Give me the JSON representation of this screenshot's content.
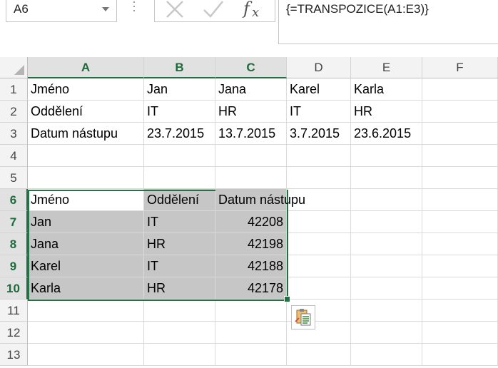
{
  "namebox": {
    "value": "A6"
  },
  "formula_bar": {
    "value": "{=TRANSPOZICE(A1:E3)}"
  },
  "columns": [
    "A",
    "B",
    "C",
    "D",
    "E",
    "F"
  ],
  "selected_columns": [
    "A",
    "B",
    "C"
  ],
  "rows": [
    "1",
    "2",
    "3",
    "4",
    "5",
    "6",
    "7",
    "8",
    "9",
    "10",
    "11",
    "12",
    "13"
  ],
  "selected_rows": [
    "6",
    "7",
    "8",
    "9",
    "10"
  ],
  "cells": {
    "A1": "Jméno",
    "B1": "Jan",
    "C1": "Jana",
    "D1": "Karel",
    "E1": "Karla",
    "A2": "Oddělení",
    "B2": "IT",
    "C2": "HR",
    "D2": "IT",
    "E2": "HR",
    "A3": "Datum nástupu",
    "B3": "23.7.2015",
    "C3": "13.7.2015",
    "D3": "3.7.2015",
    "E3": "23.6.2015",
    "A6": "Jméno",
    "B6": "Oddělení",
    "C6": "Datum nástupu",
    "A7": "Jan",
    "B7": "IT",
    "C7": "42208",
    "A8": "Jana",
    "B8": "HR",
    "C8": "42198",
    "A9": "Karel",
    "B9": "IT",
    "C9": "42188",
    "A10": "Karla",
    "B10": "HR",
    "C10": "42178"
  },
  "icons": {
    "cancel": "cancel-x-icon",
    "enter": "check-mark-icon",
    "function": "insert-function-icon",
    "paste_options": "paste-options-icon"
  },
  "colors": {
    "accent": "#217346",
    "selection_fill": "#c6c6c6"
  }
}
